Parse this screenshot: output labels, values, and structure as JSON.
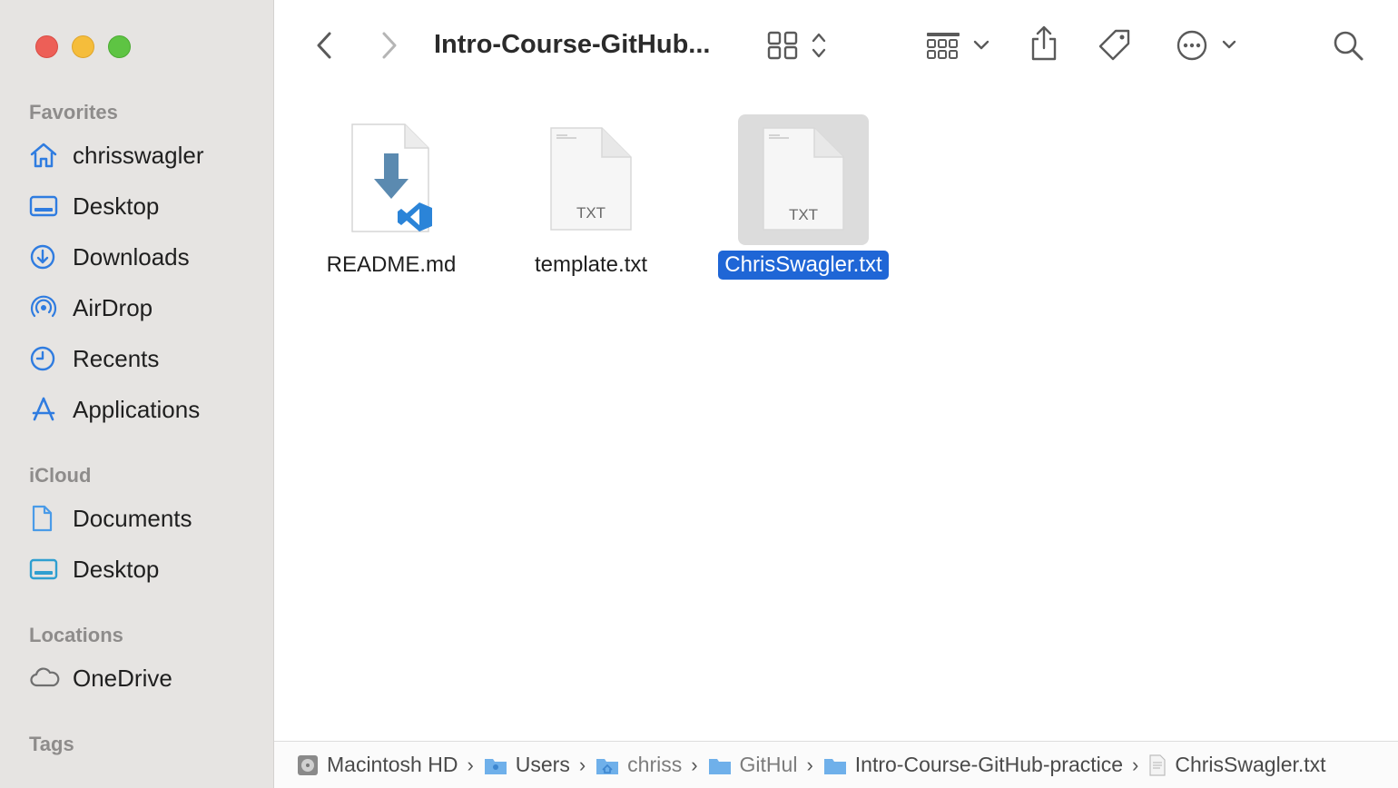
{
  "window": {
    "title": "Intro-Course-GitHub..."
  },
  "sidebar": {
    "sections": [
      {
        "title": "Favorites",
        "items": [
          {
            "label": "chrisswagler",
            "icon": "home-icon"
          },
          {
            "label": "Desktop",
            "icon": "desktop-icon"
          },
          {
            "label": "Downloads",
            "icon": "downloads-icon"
          },
          {
            "label": "AirDrop",
            "icon": "airdrop-icon"
          },
          {
            "label": "Recents",
            "icon": "clock-icon"
          },
          {
            "label": "Applications",
            "icon": "applications-icon"
          }
        ]
      },
      {
        "title": "iCloud",
        "items": [
          {
            "label": "Documents",
            "icon": "document-icon"
          },
          {
            "label": "Desktop",
            "icon": "desktop-icon"
          }
        ]
      },
      {
        "title": "Locations",
        "items": [
          {
            "label": "OneDrive",
            "icon": "cloud-icon"
          }
        ]
      },
      {
        "title": "Tags",
        "items": []
      }
    ]
  },
  "toolbar": {
    "icons": [
      "back-icon",
      "forward-icon",
      "icon-view-icon",
      "group-icon",
      "share-icon",
      "tag-icon",
      "more-icon",
      "search-icon"
    ]
  },
  "files": [
    {
      "name": "README.md",
      "type": "vscode-markdown",
      "selected": false
    },
    {
      "name": "template.txt",
      "type": "txt",
      "badge": "TXT",
      "selected": false
    },
    {
      "name": "ChrisSwagler.txt",
      "type": "txt",
      "badge": "TXT",
      "selected": true
    }
  ],
  "pathbar": [
    {
      "label": "Macintosh HD",
      "icon": "disk-icon"
    },
    {
      "label": "Users",
      "icon": "folder-users-icon"
    },
    {
      "label": "chriss",
      "icon": "folder-home-icon"
    },
    {
      "label": "GitHul",
      "icon": "folder-icon"
    },
    {
      "label": "Intro-Course-GitHub-practice",
      "icon": "folder-icon"
    },
    {
      "label": "ChrisSwagler.txt",
      "icon": "text-file-icon"
    }
  ],
  "colors": {
    "accent": "#1f66d6",
    "sidebar_bg": "#e6e4e2",
    "sidebar_icon": "#2f7ce0"
  }
}
